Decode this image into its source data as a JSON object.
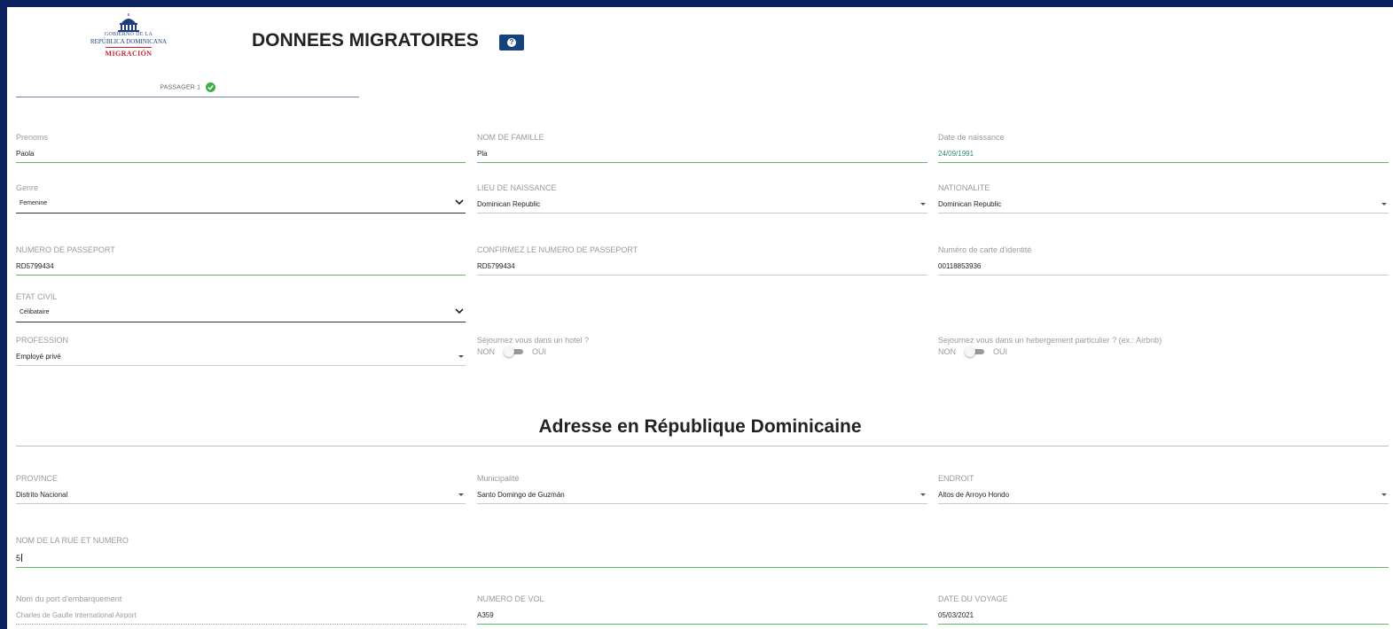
{
  "header": {
    "logo": {
      "line1": "GOBIERNO DE LA",
      "line2": "REPÚBLICA DOMINICANA",
      "line3": "MIGRACIÓN"
    },
    "title": "DONNEES MIGRATOIRES",
    "help_icon": "question-icon"
  },
  "tabs": [
    {
      "label": "PASSAGER 1",
      "status_icon": "check-circle-icon",
      "status_color": "#3cb043"
    }
  ],
  "personal": {
    "prenoms": {
      "label": "Prenoms",
      "value": "Paola"
    },
    "nom_famille": {
      "label": "NOM DE FAMILLE",
      "value": "Pla"
    },
    "date_naissance": {
      "label": "Date de naissance",
      "value": "24/09/1991"
    },
    "genre": {
      "label": "Genre",
      "value": "Femenine"
    },
    "lieu_naissance": {
      "label": "LIEU DE NAISSANCE",
      "value": "Dominican Republic"
    },
    "nationalite": {
      "label": "NATIONALITE",
      "value": "Dominican Republic"
    },
    "passeport": {
      "label": "NUMERO DE PASSEPORT",
      "value": "RD5799434"
    },
    "passeport_confirm": {
      "label": "CONFIRMEZ LE NUMERO DE PASSEPORT",
      "value": "RD5799434"
    },
    "carte_identite": {
      "label": "Numéro de carte d'identité",
      "value": "00118853936"
    },
    "etat_civil": {
      "label": "ETAT CIVIL",
      "value": "Célibataire"
    },
    "profession": {
      "label": "PROFESSION",
      "value": "Employé privé"
    }
  },
  "stay": {
    "hotel": {
      "question": "Séjournez vous dans un hotel ?",
      "no": "NON",
      "yes": "OUI"
    },
    "private": {
      "question": "Sejournez vous dans un hebergement particulier ? (ex.: Airbnb)",
      "no": "NON",
      "yes": "OUI"
    }
  },
  "address": {
    "section_title": "Adresse en République Dominicaine",
    "province": {
      "label": "PROVINCE",
      "value": "Distrito Nacional"
    },
    "municipalite": {
      "label": "Municipalité",
      "value": "Santo Domingo de Guzmán"
    },
    "endroit": {
      "label": "ENDROIT",
      "value": "Altos de Arroyo Hondo"
    },
    "rue": {
      "label": "NOM DE LA RUE ET NUMERO",
      "value": "5"
    }
  },
  "travel": {
    "port": {
      "label": "Nom du port d'embarquement",
      "value": "Charles de Gaulle International Airport"
    },
    "vol": {
      "label": "NUMERO DE VOL",
      "value": "A359"
    },
    "date": {
      "label": "DATE DU VOYAGE",
      "value": "05/03/2021"
    }
  },
  "colors": {
    "frame": "#0b2160",
    "valid_underline": "#5cb85c",
    "help_button": "#15427f",
    "tab_underline": "#6f7fbf"
  }
}
